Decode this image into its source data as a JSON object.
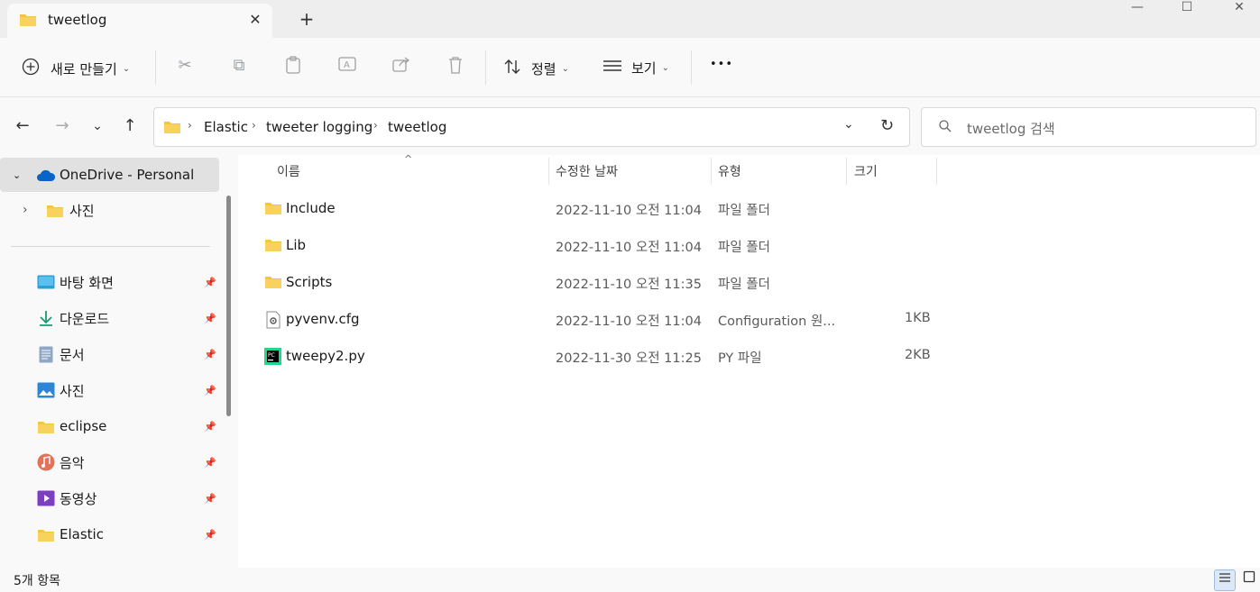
{
  "tab": {
    "title": "tweetlog",
    "close": "✕",
    "new": "+"
  },
  "window": {
    "minimize": "—",
    "maximize": "☐",
    "close": "✕"
  },
  "toolbar": {
    "new_label": "새로 만들기",
    "sort_label": "정렬",
    "view_label": "보기",
    "more": "•••"
  },
  "address": {
    "crumbs": [
      "Elastic",
      "tweeter logging",
      "tweetlog"
    ]
  },
  "search": {
    "placeholder": "tweetlog 검색"
  },
  "sidebar": {
    "onedrive": "OneDrive - Personal",
    "onedrive_child": "사진",
    "quick": [
      {
        "label": "바탕 화면",
        "icon": "desktop-icon"
      },
      {
        "label": "다운로드",
        "icon": "download-icon"
      },
      {
        "label": "문서",
        "icon": "document-icon"
      },
      {
        "label": "사진",
        "icon": "pictures-icon"
      },
      {
        "label": "eclipse",
        "icon": "folder-icon"
      },
      {
        "label": "음악",
        "icon": "music-icon"
      },
      {
        "label": "동영상",
        "icon": "video-icon"
      },
      {
        "label": "Elastic",
        "icon": "folder-icon"
      }
    ]
  },
  "columns": {
    "name": "이름",
    "date": "수정한 날짜",
    "type": "유형",
    "size": "크기"
  },
  "files": [
    {
      "name": "Include",
      "date": "2022-11-10 오전 11:04",
      "type": "파일 폴더",
      "size": "",
      "icon": "folder-icon"
    },
    {
      "name": "Lib",
      "date": "2022-11-10 오전 11:04",
      "type": "파일 폴더",
      "size": "",
      "icon": "folder-icon"
    },
    {
      "name": "Scripts",
      "date": "2022-11-10 오전 11:35",
      "type": "파일 폴더",
      "size": "",
      "icon": "folder-icon"
    },
    {
      "name": "pyvenv.cfg",
      "date": "2022-11-10 오전 11:04",
      "type": "Configuration 원...",
      "size": "1KB",
      "icon": "config-file-icon"
    },
    {
      "name": "tweepy2.py",
      "date": "2022-11-30 오전 11:25",
      "type": "PY 파일",
      "size": "2KB",
      "icon": "pycharm-file-icon"
    }
  ],
  "status": {
    "count": "5개 항목"
  },
  "colors": {
    "folder": "#f4c542",
    "accent": "#0067c0",
    "selected": "#e1e1e1"
  }
}
